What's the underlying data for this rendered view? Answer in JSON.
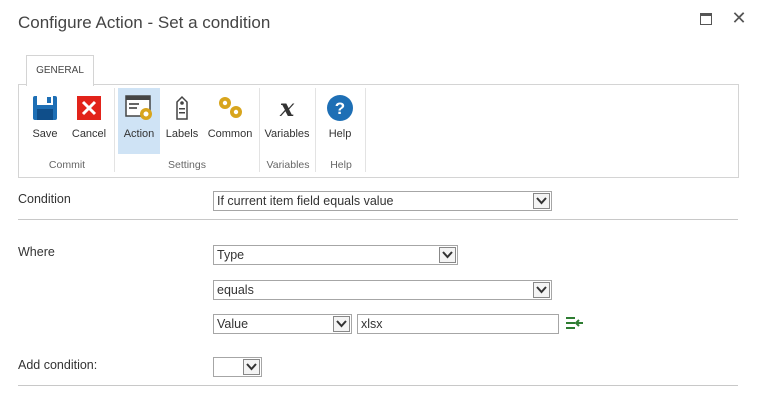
{
  "window": {
    "title": "Configure Action - Set a condition"
  },
  "ribbon": {
    "tab": "GENERAL",
    "buttons": [
      {
        "label": "Save",
        "icon": "save-icon"
      },
      {
        "label": "Cancel",
        "icon": "cancel-icon"
      },
      {
        "label": "Action",
        "icon": "action-icon",
        "active": true
      },
      {
        "label": "Labels",
        "icon": "labels-icon"
      },
      {
        "label": "Common",
        "icon": "common-icon"
      },
      {
        "label": "Variables",
        "icon": "variables-icon"
      },
      {
        "label": "Help",
        "icon": "help-icon"
      }
    ],
    "groups": [
      "Commit",
      "Settings",
      "Variables",
      "Help"
    ]
  },
  "form": {
    "condition_label": "Condition",
    "condition_value": "If current item field equals value",
    "where_label": "Where",
    "field_value": "Type",
    "operator_value": "equals",
    "value_type": "Value",
    "value_text": "xlsx",
    "add_condition_label": "Add condition:",
    "add_condition_value": ""
  },
  "colors": {
    "active_button_bg": "#cfe3f5",
    "save_blue": "#1e6fb5",
    "cancel_red": "#e2231a",
    "help_blue": "#1e6fb5",
    "gear_gold": "#d8a51d"
  }
}
